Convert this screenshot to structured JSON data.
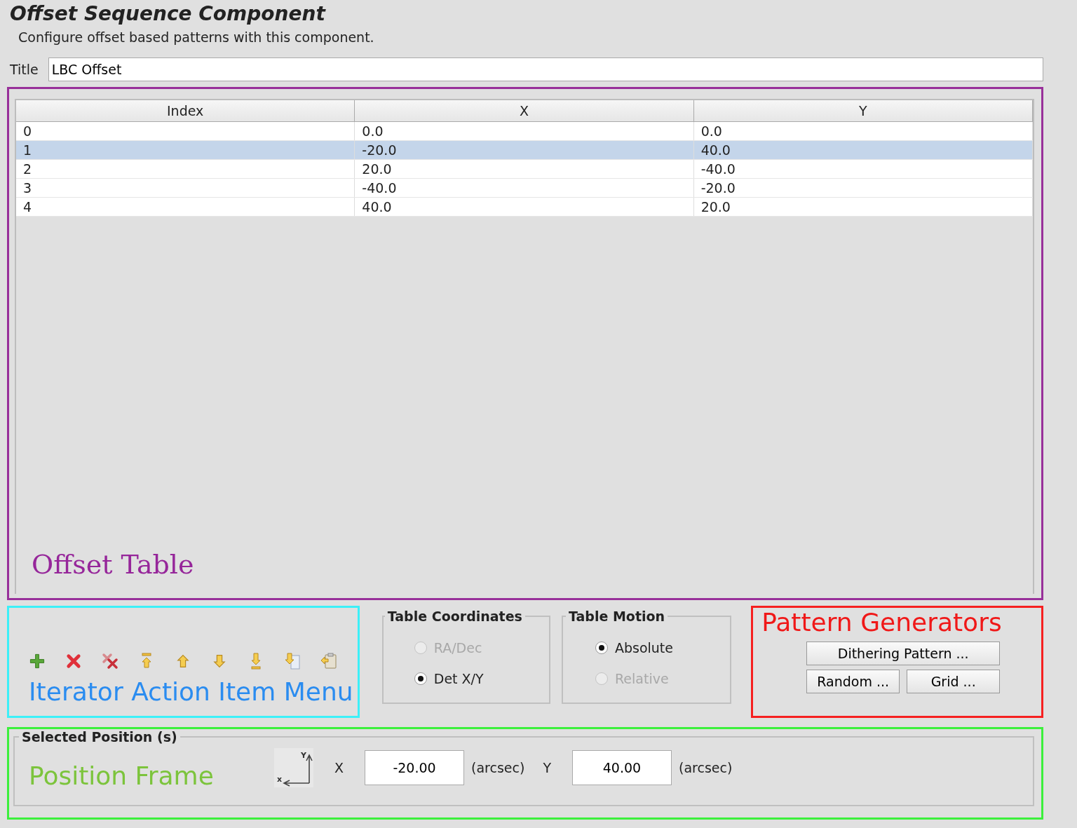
{
  "header": {
    "title": "Offset Sequence Component",
    "subtitle": "Configure offset based patterns with this component."
  },
  "title_field": {
    "label": "Title",
    "value": "LBC Offset"
  },
  "offset_table": {
    "annotation": "Offset Table",
    "columns": [
      "Index",
      "X",
      "Y"
    ],
    "rows": [
      {
        "cells": [
          "0",
          "0.0",
          "0.0"
        ],
        "selected": false
      },
      {
        "cells": [
          "1",
          "-20.0",
          "40.0"
        ],
        "selected": true
      },
      {
        "cells": [
          "2",
          "20.0",
          "-40.0"
        ],
        "selected": false
      },
      {
        "cells": [
          "3",
          "-40.0",
          "-20.0"
        ],
        "selected": false
      },
      {
        "cells": [
          "4",
          "40.0",
          "20.0"
        ],
        "selected": false
      }
    ]
  },
  "action_menu": {
    "annotation": "Iterator Action Item Menu",
    "icons": [
      {
        "kind": "add"
      },
      {
        "kind": "remove"
      },
      {
        "kind": "remove-all"
      },
      {
        "kind": "top"
      },
      {
        "kind": "up"
      },
      {
        "kind": "down"
      },
      {
        "kind": "bottom"
      },
      {
        "kind": "export"
      },
      {
        "kind": "paste"
      }
    ]
  },
  "table_coordinates": {
    "legend": "Table Coordinates",
    "options": [
      {
        "label": "RA/Dec",
        "selected": false,
        "disabled": true
      },
      {
        "label": "Det X/Y",
        "selected": true,
        "disabled": false
      }
    ]
  },
  "table_motion": {
    "legend": "Table Motion",
    "options": [
      {
        "label": "Absolute",
        "selected": true,
        "disabled": false
      },
      {
        "label": "Relative",
        "selected": false,
        "disabled": true
      }
    ]
  },
  "pattern_generators": {
    "annotation": "Pattern Generators",
    "buttons": [
      [
        "Dithering Pattern ..."
      ],
      [
        "Random ...",
        "Grid ..."
      ]
    ]
  },
  "selected_position": {
    "legend": "Selected Position (s)",
    "annotation": "Position Frame",
    "axis_icon": {
      "y_label": "Y",
      "x_label": "x"
    },
    "x_label": "X",
    "x_value": "-20.00",
    "x_unit": "(arcsec)",
    "y_label": "Y",
    "y_value": "40.00",
    "y_unit": "(arcsec)"
  }
}
